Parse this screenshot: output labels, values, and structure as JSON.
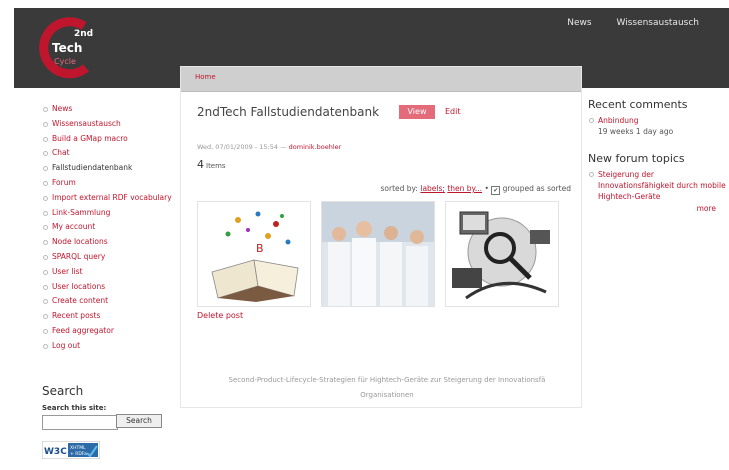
{
  "header": {
    "logo_text_top": "2nd",
    "logo_text_mid": "Tech",
    "logo_text_bottom": "Cycle",
    "nav": [
      "News",
      "Wissensaustausch"
    ]
  },
  "breadcrumb": "Home",
  "node": {
    "title": "2ndTech Fallstudiendatenbank",
    "tab_view": "View",
    "tab_edit": "Edit",
    "date": "Wed, 07/01/2009 - 15:54",
    "separator": "—",
    "author": "dominik.boehler",
    "count": "4",
    "count_label": "Items",
    "sorted_prefix": "sorted by:",
    "sort_labels": "labels;",
    "sort_then": "then by...",
    "sort_grouped": "grouped as sorted",
    "delete_link": "Delete post",
    "footer_line1": "Second-Product-Lifecycle-Strategien für Hightech-Geräte zur Steigerung der Innovationsfä",
    "footer_line2": "Organisationen"
  },
  "sidebar": {
    "items": [
      {
        "label": "News"
      },
      {
        "label": "Wissensaustausch"
      },
      {
        "label": "Build a GMap macro"
      },
      {
        "label": "Chat"
      },
      {
        "label": "Fallstudiendatenbank",
        "active": true
      },
      {
        "label": "Forum"
      },
      {
        "label": "Import external RDF vocabulary"
      },
      {
        "label": "Link-Sammlung"
      },
      {
        "label": "My account"
      },
      {
        "label": "Node locations"
      },
      {
        "label": "SPARQL query"
      },
      {
        "label": "User list"
      },
      {
        "label": "User locations"
      },
      {
        "label": "Create content"
      },
      {
        "label": "Recent posts"
      },
      {
        "label": "Feed aggregator"
      },
      {
        "label": "Log out"
      }
    ]
  },
  "search": {
    "heading": "Search",
    "label": "Search this site:",
    "value": "",
    "button": "Search"
  },
  "badge": {
    "text_w3c": "W3C",
    "text_xhtml": "XHTML",
    "text_rdfa": "+ RDFa"
  },
  "recent_comments": {
    "heading": "Recent comments",
    "items": [
      {
        "title": "Anbindung",
        "meta": "19 weeks 1 day ago"
      }
    ]
  },
  "forum_topics": {
    "heading": "New forum topics",
    "items": [
      {
        "title": "Steigerung der Innovationsfähigkeit durch mobile Hightech-Geräte"
      }
    ],
    "more": "more"
  },
  "colors": {
    "accent": "#c0162d",
    "header": "#3a3a3a",
    "view_tab": "#e36b7a"
  }
}
